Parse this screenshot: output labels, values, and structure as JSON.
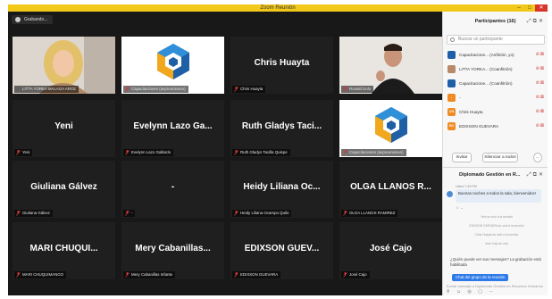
{
  "window": {
    "title": "Zoom Reunión"
  },
  "recording": {
    "label": "Grabando..."
  },
  "colors": {
    "titlebar": "#f2c81a",
    "active_speaker": "#a9d63a",
    "accent": "#2d7ae8",
    "muted": "#d13a3a"
  },
  "tiles": [
    {
      "name": "",
      "label": "LITTA YORKA MALAGA ARCE",
      "type": "camera",
      "muted": false,
      "active": true
    },
    {
      "name": "",
      "label": "Capacitaciones (avpreuniones)",
      "type": "logo",
      "muted": true
    },
    {
      "name": "Chris Huayta",
      "label": "Chris Huayta",
      "type": "name",
      "muted": true
    },
    {
      "name": "",
      "label": "Ronald Dolo",
      "type": "camera2",
      "muted": true
    },
    {
      "name": "Yeni",
      "label": "Yeni",
      "type": "name",
      "muted": true
    },
    {
      "name": "Evelynn Lazo Ga...",
      "label": "Evelynn Lazo Gallardo",
      "type": "name",
      "muted": true
    },
    {
      "name": "Ruth Gladys Taci...",
      "label": "Ruth Gladys Tacilla Quispe",
      "type": "name",
      "muted": true
    },
    {
      "name": "",
      "label": "Capacitaciones (avpreuniones)",
      "type": "logo",
      "muted": true
    },
    {
      "name": "Giuliana Gálvez",
      "label": "Giuliana Gálvez",
      "type": "name",
      "muted": true
    },
    {
      "name": "-",
      "label": "-",
      "type": "name",
      "muted": true
    },
    {
      "name": "Heidy Liliana Oc...",
      "label": "Heidy Liliana Ocampo Quilo",
      "type": "name",
      "muted": true
    },
    {
      "name": "OLGA LLANOS R...",
      "label": "OLGA LLANOS RAMIREZ",
      "type": "name",
      "muted": true
    },
    {
      "name": "MARI CHUQUI...",
      "label": "MARI CHUQUIMANGO",
      "type": "name",
      "muted": true
    },
    {
      "name": "Mery Cabanillas...",
      "label": "Mery Cabanillas Infante",
      "type": "name",
      "muted": true
    },
    {
      "name": "EDIXSON GUEV...",
      "label": "EDIXSON GUEVARA",
      "type": "name",
      "muted": true
    },
    {
      "name": "José Cajo",
      "label": "José Cajo",
      "type": "name",
      "muted": true
    }
  ],
  "participants_panel": {
    "title": "Participantes (16)",
    "search_placeholder": "Buscar un participante",
    "items": [
      {
        "name": "Capacitacione... (Anfitrión, yo)",
        "initials": "",
        "avatar_color": "#1f5fa8"
      },
      {
        "name": "LITTA YORKA... (Coanfitrión)",
        "initials": "",
        "avatar_color": "#b88a6a"
      },
      {
        "name": "Capacitacione... (Coanfitrión)",
        "initials": "",
        "avatar_color": "#1f5fa8"
      },
      {
        "name": "-",
        "initials": "-",
        "avatar_color": "#f08b24"
      },
      {
        "name": "Chris Huayta",
        "initials": "CH",
        "avatar_color": "#f08b24"
      },
      {
        "name": "EDIXSON GUEVARA",
        "initials": "EG",
        "avatar_color": "#f08b24"
      }
    ],
    "invite_label": "Invitar",
    "mute_all_label": "Silenciar a todos",
    "more_label": "..."
  },
  "chat_panel": {
    "title": "Diplomado Gestión en R...",
    "message_meta": "Usted 7:49 PM",
    "message": "Buenas noches a todos la sala, bienvenidos!",
    "system_lines": [
      "Yeni se unió a la reunión",
      "EDIXSON GUEVARA se unió a la reunión",
      "Chris Huayta se unió a la reunión",
      "José Cajo se unió"
    ],
    "notice": "¿Quién puede ver sus mensajes? La grabación está habilitada",
    "destination_label": "Chat del grupo de la reunión",
    "compose_placeholder": "Enviar mensaje a Diplomado Gestión en Recursos Humanos"
  }
}
